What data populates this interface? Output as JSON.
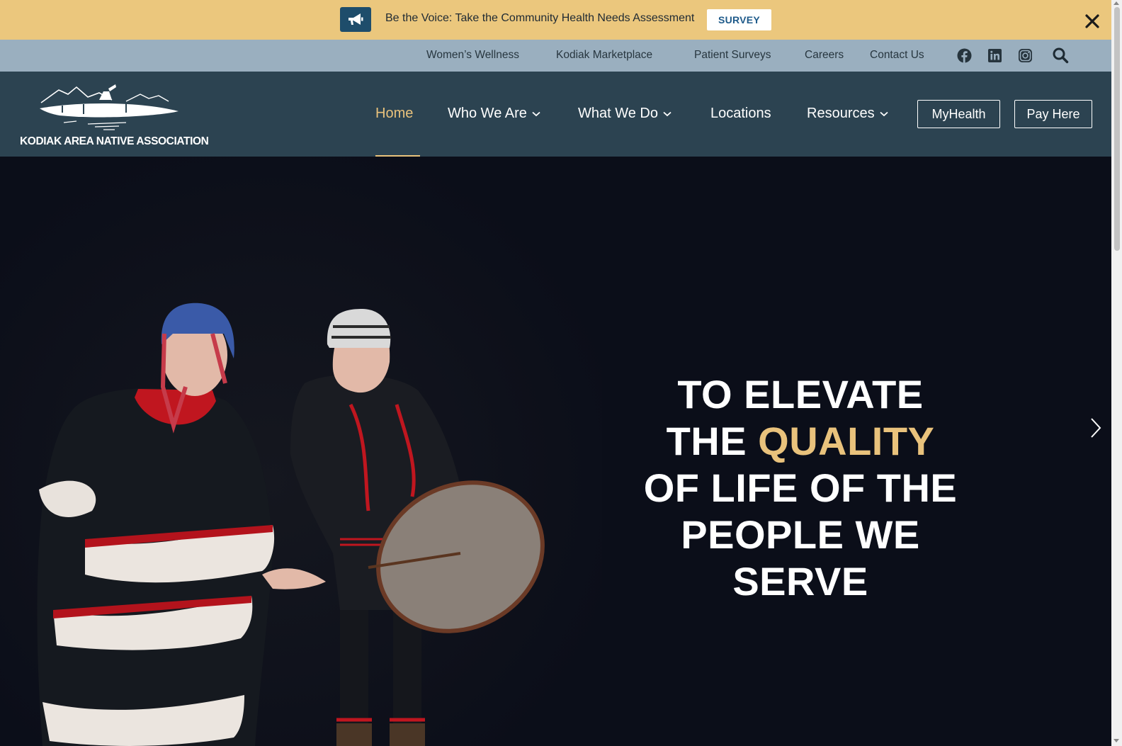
{
  "announcement": {
    "message": "Be the Voice: Take the Community Health Needs Assessment",
    "button_label": "SURVEY",
    "icon": "megaphone-icon",
    "close_icon": "close-icon"
  },
  "utility_nav": {
    "links": [
      "Women’s Wellness",
      "Kodiak Marketplace",
      "Patient Surveys",
      "Careers",
      "Contact Us"
    ],
    "social": [
      "facebook-icon",
      "linkedin-icon",
      "instagram-icon"
    ],
    "search_icon": "search-icon"
  },
  "header": {
    "logo_text": "KODIAK AREA NATIVE ASSOCIATION",
    "nav": [
      {
        "label": "Home",
        "active": true
      },
      {
        "label": "Who We Are",
        "dropdown": true
      },
      {
        "label": "What We Do",
        "dropdown": true
      },
      {
        "label": "Locations"
      },
      {
        "label": "Resources",
        "dropdown": true
      }
    ],
    "buttons": [
      "MyHealth",
      "Pay Here"
    ]
  },
  "hero": {
    "headline_1": "TO ELEVATE",
    "headline_2a": "THE ",
    "headline_2b": "QUALITY",
    "headline_3": "OF LIFE OF THE",
    "headline_4": "PEOPLE WE",
    "headline_5": "SERVE",
    "next_icon": "chevron-right-icon"
  },
  "colors": {
    "announcement_bg": "#ebc77d",
    "utility_bg": "#9aafbf",
    "header_bg": "#2c4351",
    "accent_gold": "#e9c27c",
    "hero_bg": "#0b0e19"
  }
}
